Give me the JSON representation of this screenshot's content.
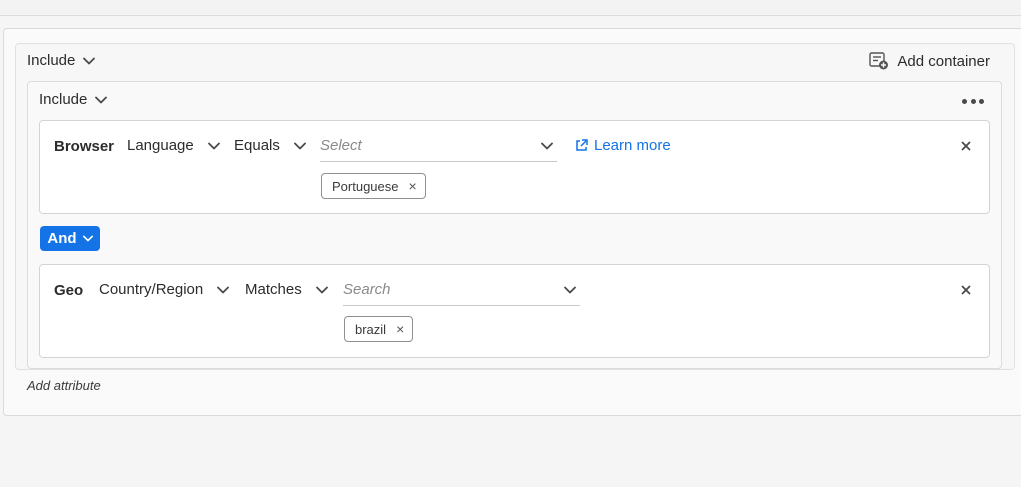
{
  "outer": {
    "include_label": "Include",
    "add_container_label": "Add container"
  },
  "inner": {
    "include_label": "Include"
  },
  "rules": [
    {
      "attribute": "Browser",
      "dimension": "Language",
      "operator": "Equals",
      "placeholder": "Select",
      "tag": "Portuguese",
      "link": "Learn more"
    },
    {
      "attribute": "Geo",
      "dimension": "Country/Region",
      "operator": "Matches",
      "placeholder": "Search",
      "tag": "brazil"
    }
  ],
  "conjunction": "And",
  "add_attribute": "Add attribute",
  "icons": {
    "chevron": "chevron-down-icon",
    "add_container": "add-container-icon",
    "more": "more-icon",
    "close": "close-icon",
    "external_link": "external-link-icon"
  },
  "colors": {
    "accent": "#1473e6"
  }
}
